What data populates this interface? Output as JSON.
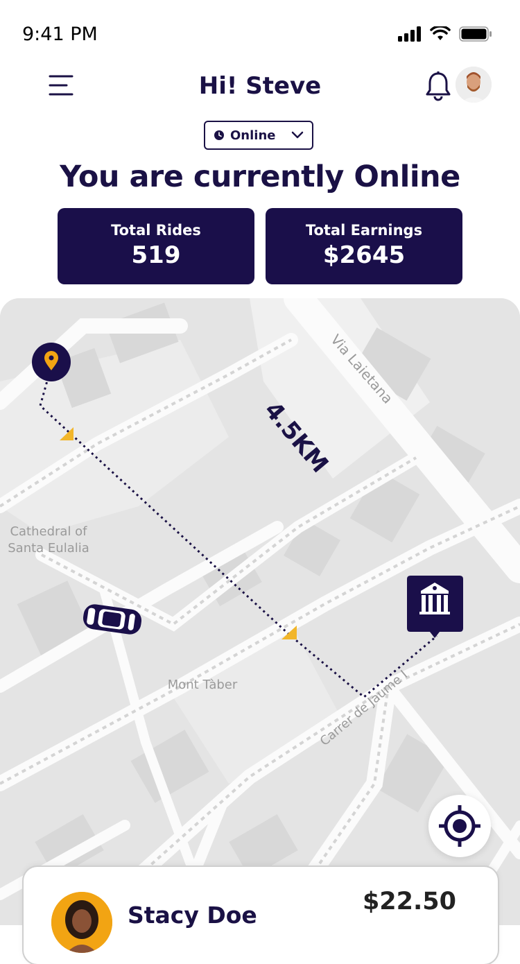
{
  "status_bar": {
    "time": "9:41 PM"
  },
  "header": {
    "greeting": "Hi! Steve"
  },
  "status_select": {
    "value": "Online"
  },
  "headline": "You are currently Online",
  "stats": [
    {
      "label": "Total Rides",
      "value": "519"
    },
    {
      "label": "Total Earnings",
      "value": "$2645"
    }
  ],
  "map": {
    "distance_label": "4.5KM",
    "street_labels": [
      "Via Laietana",
      "Carrer de Jaume I"
    ],
    "place_labels": [
      "Cathedral of",
      "Santa Eulalia",
      "Mont Tàber"
    ]
  },
  "ride": {
    "rider_name": "Stacy Doe",
    "fare": "$22.50"
  },
  "colors": {
    "primary": "#1a0f4a",
    "accent": "#f2a413",
    "map_bg": "#e6e6e6"
  },
  "icons": [
    "menu-icon",
    "bell-icon",
    "clock-icon",
    "chevron-down-icon",
    "location-pin-icon",
    "car-icon",
    "destination-building-icon",
    "recenter-target-icon"
  ]
}
